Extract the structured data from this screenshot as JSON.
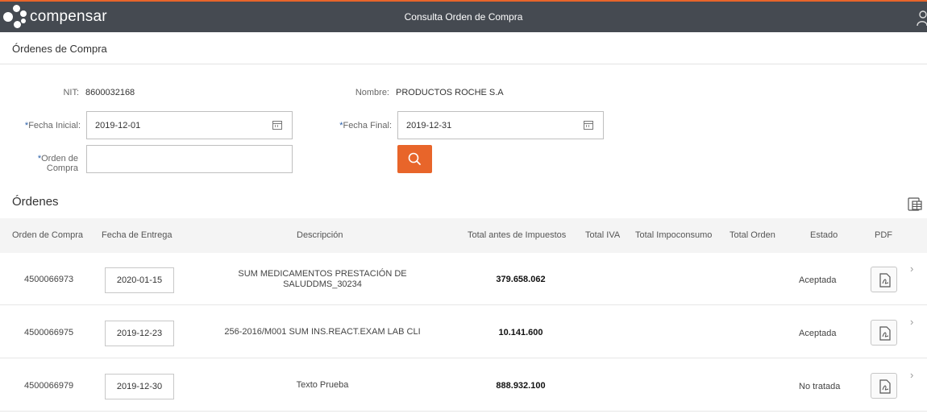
{
  "header": {
    "logo_text": "compensar",
    "title": "Consulta Orden de Compra"
  },
  "breadcrumb": "Órdenes de Compra",
  "form": {
    "nit_label": "NIT:",
    "nit_value": "8600032168",
    "nombre_label": "Nombre:",
    "nombre_value": "PRODUCTOS ROCHE S.A",
    "required_mark": "*",
    "fecha_inicial_label": "Fecha Inicial:",
    "fecha_inicial_value": "2019-12-01",
    "fecha_final_label": "Fecha Final:",
    "fecha_final_value": "2019-12-31",
    "orden_label_1": "Orden de",
    "orden_label_2": "Compra",
    "orden_value": ""
  },
  "section_title": "Órdenes",
  "table": {
    "columns": [
      "Orden de Compra",
      "Fecha de Entrega",
      "Descripción",
      "Total antes de Impuestos",
      "Total IVA",
      "Total Impoconsumo",
      "Total Orden",
      "Estado",
      "PDF"
    ],
    "rows": [
      {
        "orden": "4500066973",
        "fecha": "2020-01-15",
        "desc_1": "SUM MEDICAMENTOS PRESTACIÓN DE",
        "desc_2": "SALUDDMS_30234",
        "total": "379.658.062",
        "estado": "Aceptada"
      },
      {
        "orden": "4500066975",
        "fecha": "2019-12-23",
        "desc_1": "256-2016/M001 SUM INS.REACT.EXAM LAB CLI",
        "desc_2": "",
        "total": "10.141.600",
        "estado": "Aceptada"
      },
      {
        "orden": "4500066979",
        "fecha": "2019-12-30",
        "desc_1": "Texto Prueba",
        "desc_2": "",
        "total": "888.932.100",
        "estado": "No tratada"
      }
    ]
  },
  "colors": {
    "topbar": "#454a51",
    "accent": "#e8652a",
    "required": "#2a5fa8"
  }
}
